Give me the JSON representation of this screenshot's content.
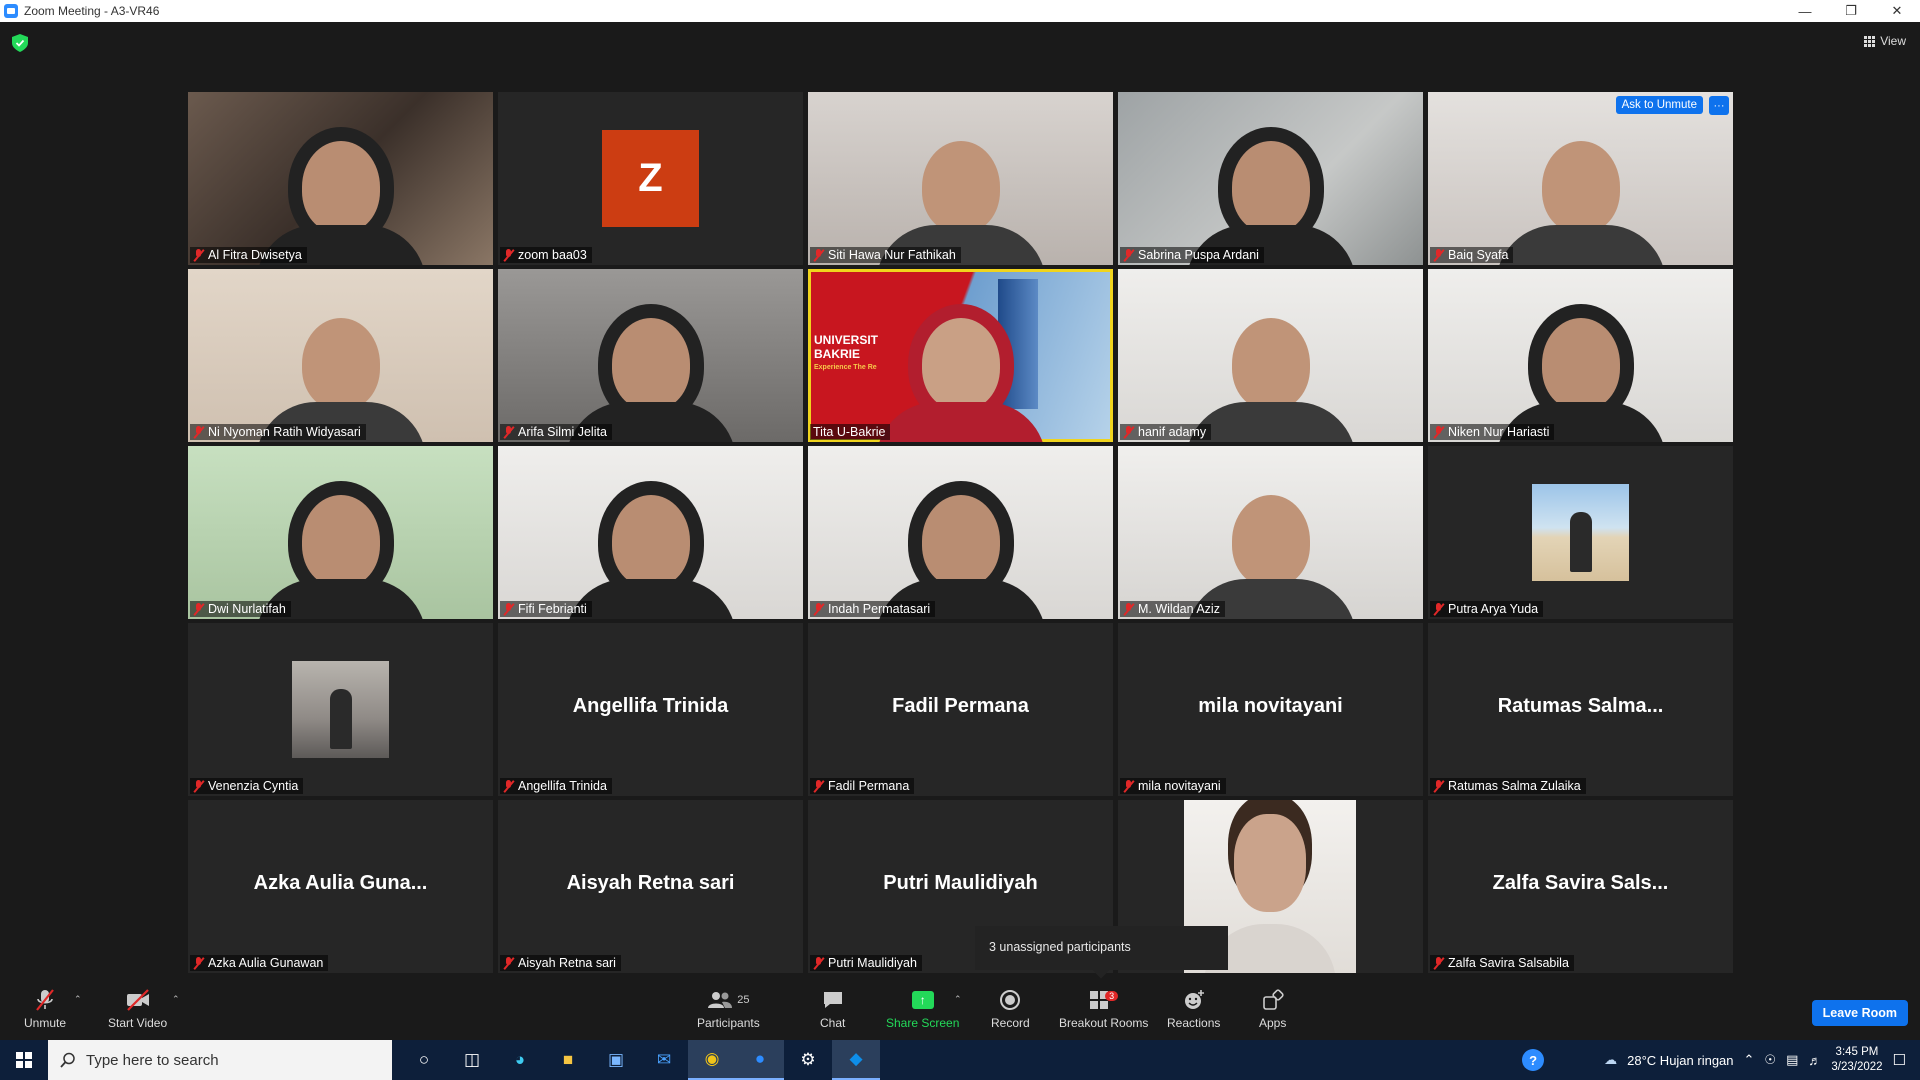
{
  "window": {
    "title": "Zoom Meeting - A3-VR46"
  },
  "view_label": "View",
  "tiles": [
    {
      "name": "Al Fitra Dwisetya",
      "type": "video",
      "bg": "bg-room1"
    },
    {
      "name": "zoom baa03",
      "type": "letter",
      "letter": "Z"
    },
    {
      "name": "Siti Hawa Nur Fathikah",
      "type": "video",
      "bg": "bg-wall-light"
    },
    {
      "name": "Sabrina Puspa Ardani",
      "type": "video",
      "bg": "bg-concrete"
    },
    {
      "name": "Baiq Syafa",
      "type": "video",
      "bg": "bg-pale",
      "ask_unmute": "Ask to Unmute",
      "more": "···"
    },
    {
      "name": "Ni Nyoman Ratih Widyasari",
      "type": "video",
      "bg": "bg-beige"
    },
    {
      "name": "Arifa Silmi Jelita",
      "type": "video",
      "bg": "bg-grey"
    },
    {
      "name": "Tita U-Bakrie",
      "type": "univ",
      "active": true,
      "mic_on": true,
      "univ_line1": "UNIVERSIT",
      "univ_line2": "BAKRIE",
      "univ_tag": "Experience The Re"
    },
    {
      "name": "hanif adamy",
      "type": "video",
      "bg": "bg-white"
    },
    {
      "name": "Niken Nur Hariasti",
      "type": "video",
      "bg": "bg-white"
    },
    {
      "name": "Dwi Nurlatifah",
      "type": "video",
      "bg": "bg-mint"
    },
    {
      "name": "Fifi Febrianti",
      "type": "video",
      "bg": "bg-white"
    },
    {
      "name": "Indah Permatasari",
      "type": "video",
      "bg": "bg-white"
    },
    {
      "name": "M. Wildan Aziz",
      "type": "video",
      "bg": "bg-frame"
    },
    {
      "name": "Putra Arya Yuda",
      "type": "thumb",
      "thumb": "thumb-beach"
    },
    {
      "name": "Venenzia Cyntia",
      "type": "thumb",
      "thumb": "thumb-girl"
    },
    {
      "name": "Angellifa Trinida",
      "type": "text",
      "display": "Angellifa Trinida"
    },
    {
      "name": "Fadil Permana",
      "type": "text",
      "display": "Fadil Permana"
    },
    {
      "name": "mila novitayani",
      "type": "text",
      "display": "mila novitayani"
    },
    {
      "name": "Ratumas Salma Zulaika",
      "type": "text",
      "display": "Ratumas  Salma..."
    },
    {
      "name": "Azka Aulia Gunawan",
      "type": "text",
      "display": "Azka  Aulia  Guna..."
    },
    {
      "name": "Aisyah Retna sari",
      "type": "text",
      "display": "Aisyah Retna sari"
    },
    {
      "name": "Putri Maulidiyah",
      "type": "text",
      "display": "Putri Maulidiyah"
    },
    {
      "name": "",
      "type": "self"
    },
    {
      "name": "Zalfa Savira Salsabila",
      "type": "text",
      "display": "Zalfa  Savira  Sals..."
    }
  ],
  "unassigned_popup": "3 unassigned participants",
  "toolbar": {
    "unmute": "Unmute",
    "start_video": "Start Video",
    "participants": "Participants",
    "participants_count": "25",
    "chat": "Chat",
    "share_screen": "Share Screen",
    "record": "Record",
    "breakout_rooms": "Breakout Rooms",
    "breakout_badge": "3",
    "reactions": "Reactions",
    "apps": "Apps",
    "leave_room": "Leave Room"
  },
  "taskbar": {
    "search_placeholder": "Type here to search",
    "weather": "28°C  Hujan ringan",
    "time": "3:45 PM",
    "date": "3/23/2022"
  },
  "colors": {
    "accent_blue": "#0e72ed",
    "share_green": "#23d959",
    "active_speaker": "#f0d41d",
    "muted_red": "#e02828"
  }
}
